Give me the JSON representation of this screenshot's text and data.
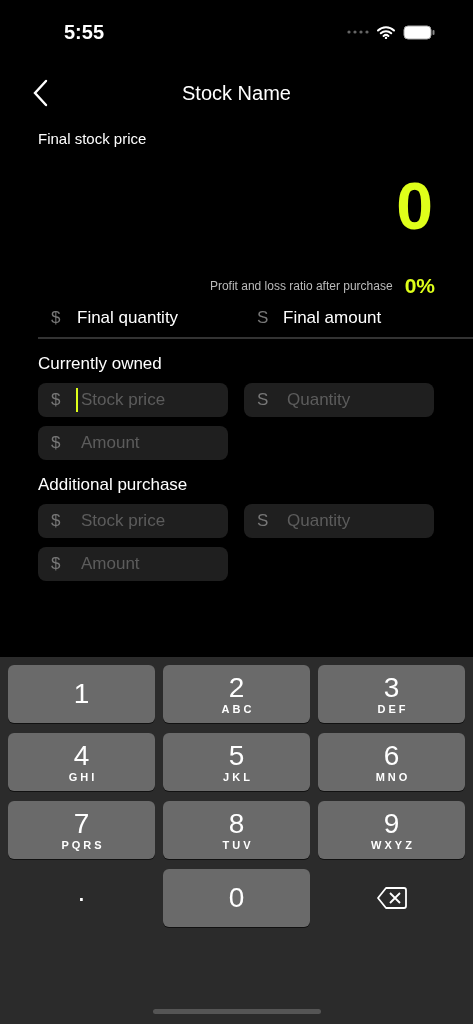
{
  "status_bar": {
    "time": "5:55"
  },
  "nav": {
    "title": "Stock Name"
  },
  "result": {
    "label": "Final stock price",
    "value": "0",
    "ratio_label": "Profit and loss ratio after purchase",
    "ratio_value": "0%"
  },
  "final_row": [
    {
      "prefix": "$",
      "label": "Final quantity"
    },
    {
      "prefix": "S",
      "label": "Final amount"
    }
  ],
  "sections": [
    {
      "title": "Currently owned",
      "fields": [
        {
          "prefix": "$",
          "placeholder": "Stock price",
          "focused": true
        },
        {
          "prefix": "S",
          "placeholder": "Quantity",
          "focused": false
        },
        {
          "prefix": "$",
          "placeholder": "Amount",
          "focused": false
        }
      ]
    },
    {
      "title": "Additional purchase",
      "fields": [
        {
          "prefix": "$",
          "placeholder": "Stock price",
          "focused": false
        },
        {
          "prefix": "S",
          "placeholder": "Quantity",
          "focused": false
        },
        {
          "prefix": "$",
          "placeholder": "Amount",
          "focused": false
        }
      ]
    }
  ],
  "keyboard_rows": [
    [
      {
        "kind": "digit",
        "digit": "1"
      },
      {
        "kind": "digit",
        "digit": "2",
        "letters": "ABC"
      },
      {
        "kind": "digit",
        "digit": "3",
        "letters": "DEF"
      }
    ],
    [
      {
        "kind": "digit",
        "digit": "4",
        "letters": "GHI"
      },
      {
        "kind": "digit",
        "digit": "5",
        "letters": "JKL"
      },
      {
        "kind": "digit",
        "digit": "6",
        "letters": "MNO"
      }
    ],
    [
      {
        "kind": "digit",
        "digit": "7",
        "letters": "PQRS"
      },
      {
        "kind": "digit",
        "digit": "8",
        "letters": "TUV"
      },
      {
        "kind": "digit",
        "digit": "9",
        "letters": "WXYZ"
      }
    ],
    [
      {
        "kind": "plain",
        "digit": "."
      },
      {
        "kind": "digit",
        "digit": "0"
      },
      {
        "kind": "delete"
      }
    ]
  ]
}
